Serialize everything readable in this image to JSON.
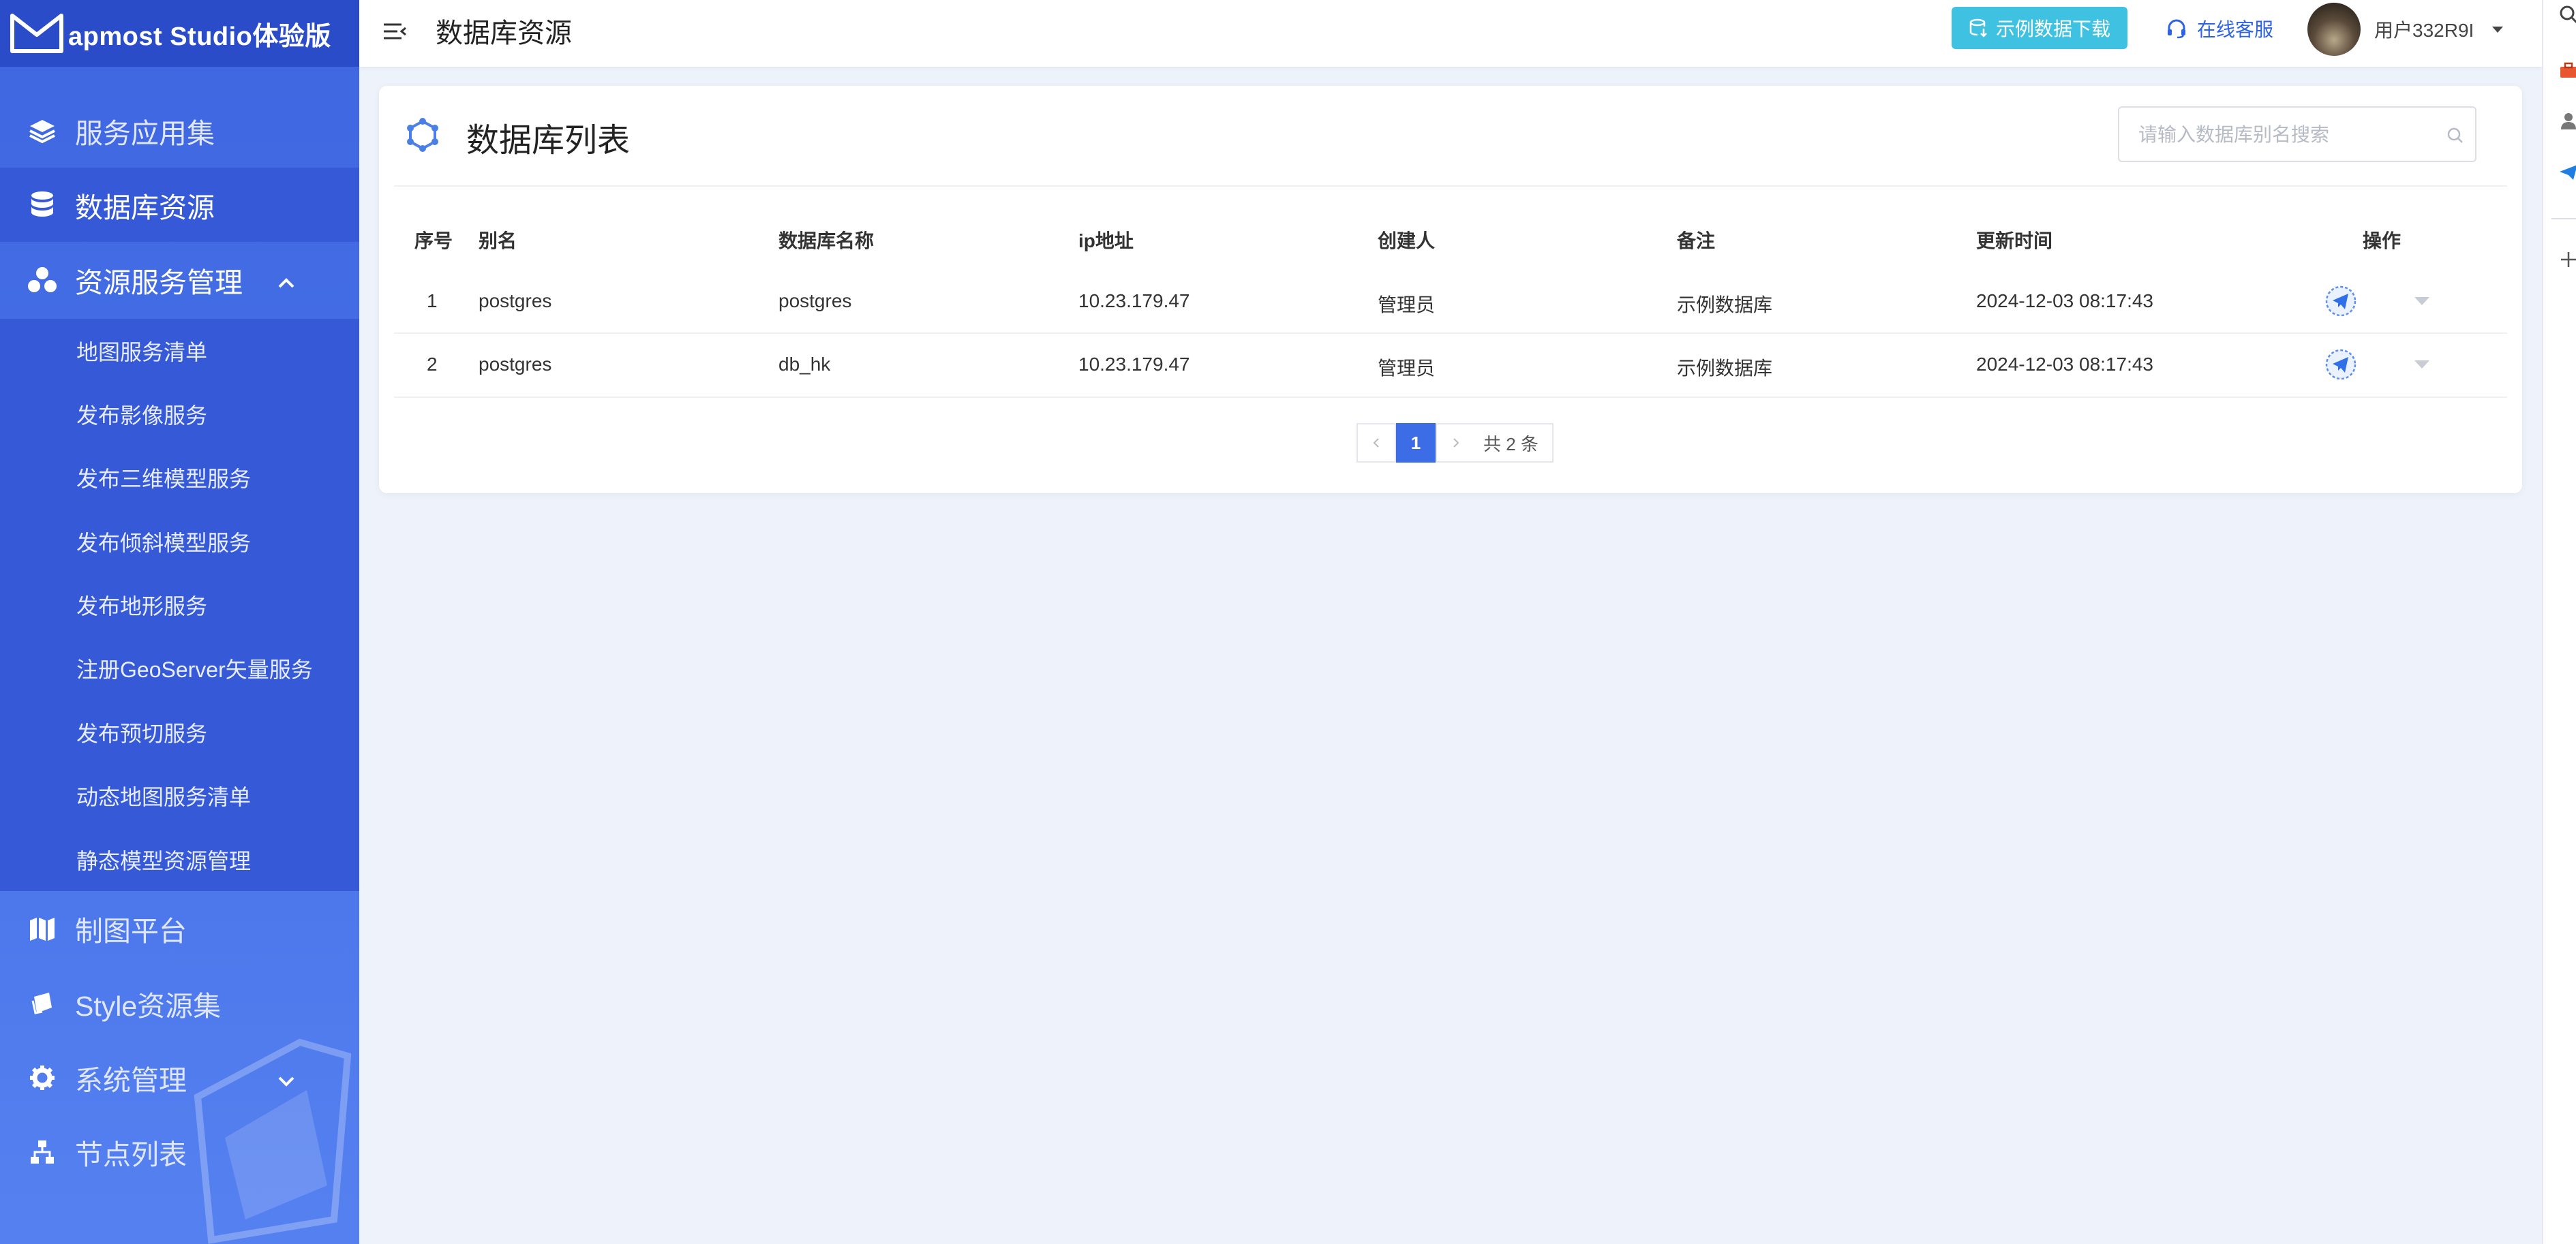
{
  "brand": {
    "name": "apmost Studio体验版"
  },
  "sidebar": {
    "items": [
      {
        "label": "服务应用集",
        "icon": "layers-icon"
      },
      {
        "label": "数据库资源",
        "icon": "database-icon"
      },
      {
        "label": "资源服务管理",
        "icon": "cubes-icon"
      },
      {
        "label": "制图平台",
        "icon": "map-icon"
      },
      {
        "label": "Style资源集",
        "icon": "paint-icon"
      },
      {
        "label": "系统管理",
        "icon": "gear-icon"
      },
      {
        "label": "节点列表",
        "icon": "sitemap-icon"
      }
    ],
    "sub_items": [
      {
        "label": "地图服务清单"
      },
      {
        "label": "发布影像服务"
      },
      {
        "label": "发布三维模型服务"
      },
      {
        "label": "发布倾斜模型服务"
      },
      {
        "label": "发布地形服务"
      },
      {
        "label": "注册GeoServer矢量服务"
      },
      {
        "label": "发布预切服务"
      },
      {
        "label": "动态地图服务清单"
      },
      {
        "label": "静态模型资源管理"
      }
    ]
  },
  "header": {
    "title": "数据库资源",
    "download_label": "示例数据下载",
    "service_label": "在线客服",
    "user_name": "用户332R9I"
  },
  "card": {
    "title": "数据库列表",
    "search_placeholder": "请输入数据库别名搜索"
  },
  "table": {
    "columns": [
      "序号",
      "别名",
      "数据库名称",
      "ip地址",
      "创建人",
      "备注",
      "更新时间",
      "操作"
    ],
    "rows": [
      {
        "index": "1",
        "alias": "postgres",
        "db_name": "postgres",
        "ip": "10.23.179.47",
        "creator": "管理员",
        "note": "示例数据库",
        "updated": "2024-12-03 08:17:43"
      },
      {
        "index": "2",
        "alias": "postgres",
        "db_name": "db_hk",
        "ip": "10.23.179.47",
        "creator": "管理员",
        "note": "示例数据库",
        "updated": "2024-12-03 08:17:43"
      }
    ]
  },
  "pagination": {
    "current": "1",
    "total_text": "共 2 条"
  },
  "colors": {
    "sidebar": "#4874ea",
    "brand_bar": "#2a4cc9",
    "submenu": "#3559d7",
    "accent": "#3d6de6",
    "download_button": "#3fc1e1",
    "background": "#eef2fa"
  }
}
